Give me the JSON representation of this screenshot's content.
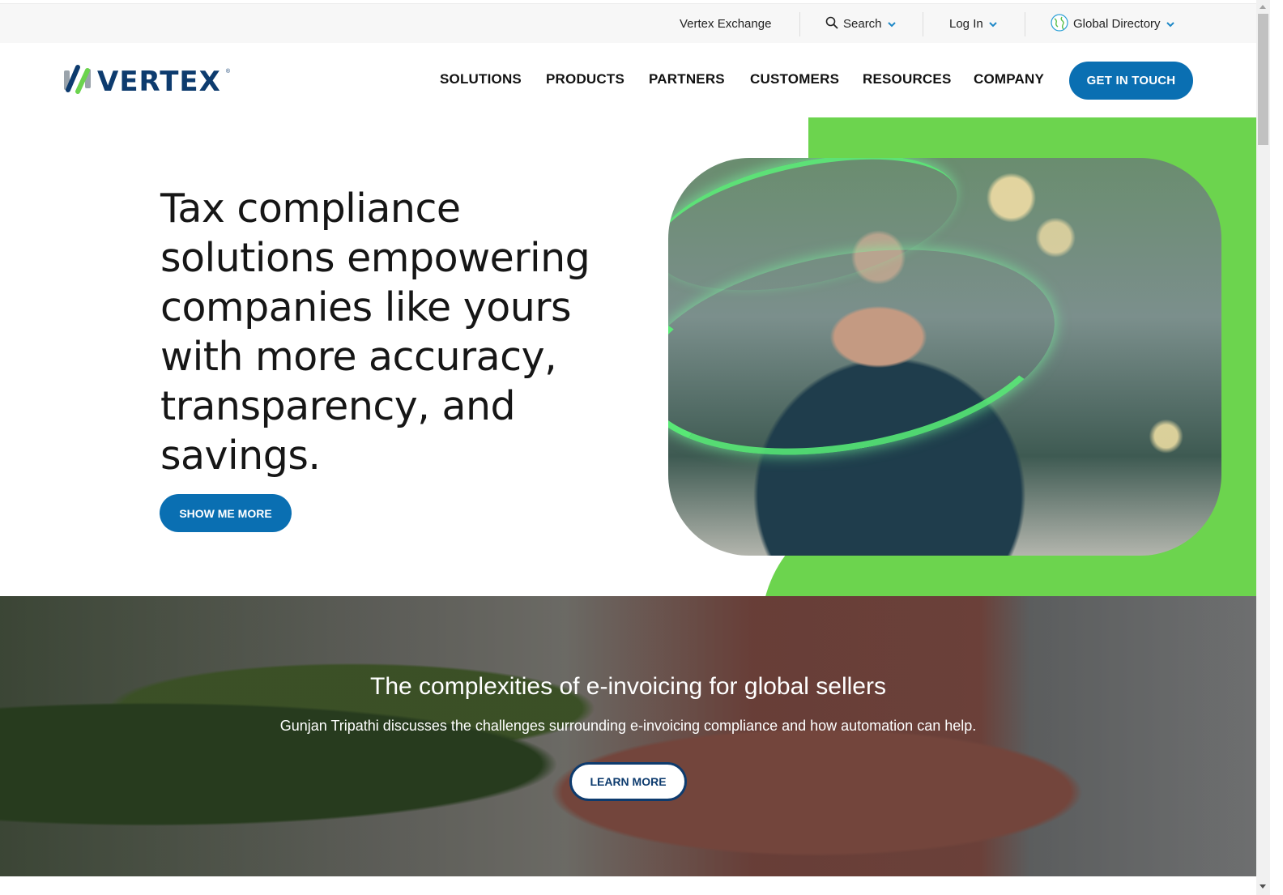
{
  "utility_bar": {
    "vertex_exchange": "Vertex Exchange",
    "search": "Search",
    "login": "Log In",
    "global_directory": "Global Directory"
  },
  "header": {
    "logo_text": "VERTEX",
    "logo_reg": "®",
    "nav": [
      "SOLUTIONS",
      "PRODUCTS",
      "PARTNERS",
      "CUSTOMERS",
      "RESOURCES",
      "COMPANY"
    ],
    "cta": "GET IN TOUCH"
  },
  "hero": {
    "title": "Tax compliance solutions empowering companies like yours with more accuracy, transparency, and savings.",
    "button": "SHOW ME MORE",
    "image_alt": "Man in suit smiling at smartphone on city street with green light swoosh"
  },
  "promo": {
    "title": "The complexities of e-invoicing for global sellers",
    "subtitle": "Gunjan Tripathi discusses the challenges surrounding e-invoicing compliance and how automation can help.",
    "button": "LEARN MORE"
  },
  "colors": {
    "brand_blue": "#0a6fb2",
    "navy": "#0d3b6e",
    "brand_green": "#6cd44e",
    "chevron_blue": "#1e88c7"
  }
}
